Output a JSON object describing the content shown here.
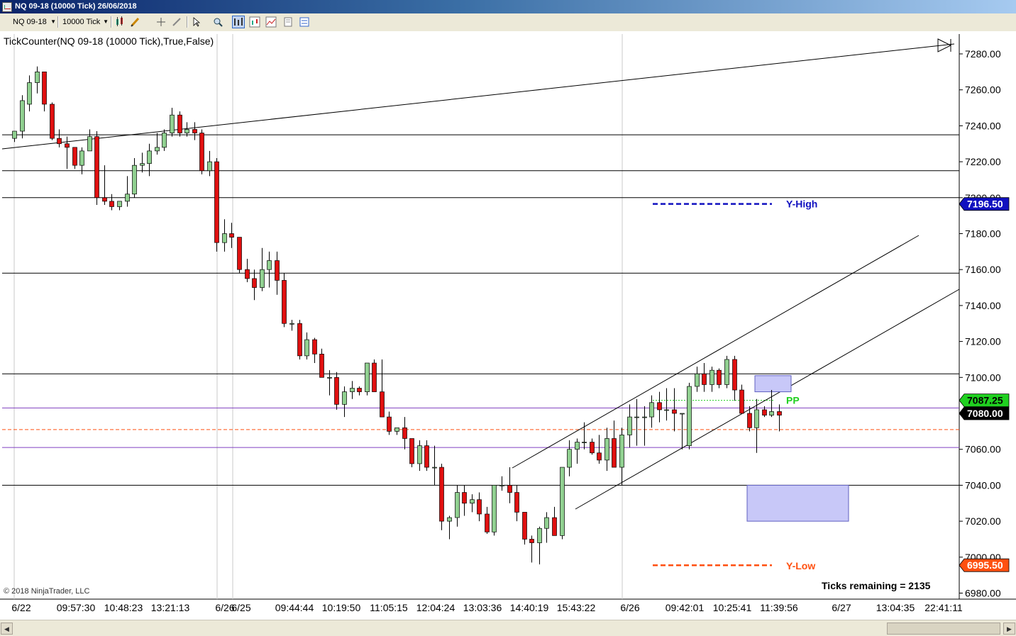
{
  "window": {
    "title": "NQ 09-18 (10000 Tick)  26/06/2018"
  },
  "toolbar": {
    "instrument": "NQ 09-18",
    "period": "10000 Tick"
  },
  "chart_title": "TickCounter(NQ 09-18 (10000 Tick),True,False)",
  "copyright": "© 2018 NinjaTrader, LLC",
  "ticks_remaining": "Ticks remaining = 2135",
  "colors": {
    "up": "#90d090",
    "down": "#e01010",
    "y_high": "#1010c0",
    "y_low": "#ff5010",
    "pp": "#20d020",
    "pivot_line": "#8040c0",
    "zone": "#c8c8f8"
  },
  "chart_data": {
    "type": "candlestick",
    "y_axis": {
      "min": 6980,
      "max": 7280,
      "ticks": [
        "7280.00",
        "7260.00",
        "7240.00",
        "7220.00",
        "7200.00",
        "7180.00",
        "7160.00",
        "7140.00",
        "7120.00",
        "7100.00",
        "7080.00",
        "7060.00",
        "7040.00",
        "7020.00",
        "7000.00",
        "6980.00"
      ]
    },
    "x_labels": [
      "6/22",
      "09:57:30",
      "10:48:23",
      "13:21:13",
      "6/26",
      "6/25",
      "09:44:44",
      "10:19:50",
      "11:05:15",
      "12:04:24",
      "13:03:36",
      "14:40:19",
      "15:43:22",
      "6/26",
      "09:42:01",
      "10:25:41",
      "11:39:56",
      "6/27",
      "13:04:35",
      "22:41:11"
    ],
    "candles": [
      [
        7233,
        7237,
        7231,
        7237
      ],
      [
        7237,
        7257,
        7233,
        7254
      ],
      [
        7252,
        7268,
        7248,
        7264
      ],
      [
        7264,
        7273,
        7258,
        7270
      ],
      [
        7270,
        7268,
        7248,
        7252
      ],
      [
        7252,
        7253,
        7232,
        7233
      ],
      [
        7233,
        7238,
        7228,
        7230
      ],
      [
        7230,
        7234,
        7216,
        7228
      ],
      [
        7228,
        7228,
        7216,
        7218
      ],
      [
        7218,
        7228,
        7213,
        7226
      ],
      [
        7226,
        7238,
        7226,
        7234
      ],
      [
        7234,
        7237,
        7196,
        7200
      ],
      [
        7200,
        7218,
        7196,
        7198
      ],
      [
        7198,
        7202,
        7193,
        7195
      ],
      [
        7195,
        7198,
        7193,
        7198
      ],
      [
        7198,
        7212,
        7195,
        7202
      ],
      [
        7202,
        7222,
        7200,
        7218
      ],
      [
        7218,
        7225,
        7214,
        7219
      ],
      [
        7219,
        7230,
        7212,
        7226
      ],
      [
        7226,
        7236,
        7224,
        7228
      ],
      [
        7228,
        7238,
        7226,
        7236
      ],
      [
        7236,
        7250,
        7234,
        7246
      ],
      [
        7246,
        7248,
        7234,
        7236
      ],
      [
        7236,
        7242,
        7234,
        7238
      ],
      [
        7238,
        7242,
        7232,
        7236
      ],
      [
        7236,
        7238,
        7213,
        7215
      ],
      [
        7215,
        7226,
        7212,
        7220
      ],
      [
        7220,
        7222,
        7170,
        7175
      ],
      [
        7175,
        7188,
        7170,
        7180
      ],
      [
        7180,
        7186,
        7172,
        7178
      ],
      [
        7178,
        7178,
        7158,
        7160
      ],
      [
        7160,
        7166,
        7153,
        7155
      ],
      [
        7155,
        7160,
        7143,
        7150
      ],
      [
        7150,
        7172,
        7148,
        7160
      ],
      [
        7160,
        7170,
        7150,
        7165
      ],
      [
        7165,
        7170,
        7146,
        7154
      ],
      [
        7154,
        7158,
        7128,
        7130
      ],
      [
        7130,
        7132,
        7126,
        7130
      ],
      [
        7130,
        7132,
        7110,
        7112
      ],
      [
        7112,
        7125,
        7110,
        7121
      ],
      [
        7121,
        7122,
        7108,
        7113
      ],
      [
        7113,
        7116,
        7100,
        7100
      ],
      [
        7100,
        7104,
        7090,
        7100
      ],
      [
        7100,
        7103,
        7082,
        7085
      ],
      [
        7085,
        7095,
        7078,
        7092
      ],
      [
        7092,
        7098,
        7088,
        7094
      ],
      [
        7094,
        7095,
        7090,
        7092
      ],
      [
        7092,
        7107,
        7090,
        7108
      ],
      [
        7108,
        7110,
        7093,
        7092
      ],
      [
        7092,
        7110,
        7080,
        7078
      ],
      [
        7078,
        7081,
        7068,
        7070
      ],
      [
        7070,
        7071,
        7068,
        7072
      ],
      [
        7072,
        7078,
        7060,
        7066
      ],
      [
        7066,
        7065,
        7050,
        7052
      ],
      [
        7052,
        7065,
        7048,
        7062
      ],
      [
        7062,
        7065,
        7048,
        7050
      ],
      [
        7050,
        7062,
        7040,
        7050
      ],
      [
        7050,
        7052,
        7015,
        7020
      ],
      [
        7020,
        7023,
        7010,
        7022
      ],
      [
        7022,
        7040,
        7017,
        7036
      ],
      [
        7036,
        7040,
        7023,
        7030
      ],
      [
        7030,
        7035,
        7025,
        7032
      ],
      [
        7032,
        7036,
        7020,
        7024
      ],
      [
        7024,
        7028,
        7013,
        7014
      ],
      [
        7014,
        7040,
        7012,
        7040
      ],
      [
        7040,
        7045,
        7037,
        7040
      ],
      [
        7040,
        7050,
        7030,
        7036
      ],
      [
        7036,
        7040,
        7020,
        7025
      ],
      [
        7025,
        7024,
        7007,
        7010
      ],
      [
        7010,
        7012,
        6997,
        7008
      ],
      [
        7008,
        7017,
        6996,
        7016
      ],
      [
        7016,
        7025,
        7008,
        7022
      ],
      [
        7022,
        7028,
        7012,
        7012
      ],
      [
        7012,
        7050,
        7010,
        7050
      ],
      [
        7050,
        7065,
        7045,
        7060
      ],
      [
        7060,
        7066,
        7052,
        7064
      ],
      [
        7064,
        7075,
        7060,
        7064
      ],
      [
        7064,
        7066,
        7057,
        7058
      ],
      [
        7058,
        7068,
        7052,
        7054
      ],
      [
        7054,
        7072,
        7048,
        7066
      ],
      [
        7066,
        7076,
        7050,
        7050
      ],
      [
        7050,
        7072,
        7040,
        7068
      ],
      [
        7068,
        7085,
        7061,
        7078
      ],
      [
        7078,
        7088,
        7062,
        7078
      ],
      [
        7078,
        7084,
        7062,
        7078
      ],
      [
        7078,
        7090,
        7072,
        7086
      ],
      [
        7086,
        7092,
        7075,
        7082
      ],
      [
        7082,
        7094,
        7076,
        7082
      ],
      [
        7082,
        7094,
        7070,
        7080
      ],
      [
        7080,
        7080,
        7060,
        7080
      ],
      [
        7062,
        7097,
        7060,
        7095
      ],
      [
        7095,
        7106,
        7092,
        7102
      ],
      [
        7102,
        7108,
        7092,
        7096
      ],
      [
        7096,
        7106,
        7092,
        7104
      ],
      [
        7104,
        7105,
        7094,
        7096
      ],
      [
        7096,
        7112,
        7094,
        7110
      ],
      [
        7110,
        7112,
        7087,
        7093
      ],
      [
        7093,
        7096,
        7080,
        7080
      ],
      [
        7080,
        7084,
        7070,
        7072
      ],
      [
        7072,
        7088,
        7058,
        7082
      ],
      [
        7082,
        7084,
        7078,
        7079
      ],
      [
        7079,
        7093,
        7078,
        7081
      ],
      [
        7081,
        7085,
        7070,
        7079
      ]
    ],
    "horizontal_lines": [
      {
        "price": 7235,
        "kind": "level"
      },
      {
        "price": 7215,
        "kind": "level"
      },
      {
        "price": 7200,
        "kind": "level"
      },
      {
        "price": 7158,
        "kind": "level"
      },
      {
        "price": 7102,
        "kind": "level"
      },
      {
        "price": 7040,
        "kind": "level"
      },
      {
        "price": 7083,
        "kind": "pivot"
      },
      {
        "price": 7061,
        "kind": "pivot"
      },
      {
        "price": 7071,
        "kind": "dashed-orange"
      }
    ],
    "y_high": {
      "label": "Y-High",
      "price": 7196.5,
      "badge": "7196.50"
    },
    "y_low": {
      "label": "Y-Low",
      "price": 6995.5,
      "badge": "6995.50"
    },
    "pp": {
      "label": "PP",
      "price": 7087.25,
      "badge": "7087.25"
    },
    "last_price": {
      "badge": "7080.00",
      "price": 7080
    },
    "zones": [
      {
        "price_top": 7101,
        "price_bottom": 7092
      },
      {
        "price_top": 7040,
        "price_bottom": 7020
      }
    ]
  }
}
